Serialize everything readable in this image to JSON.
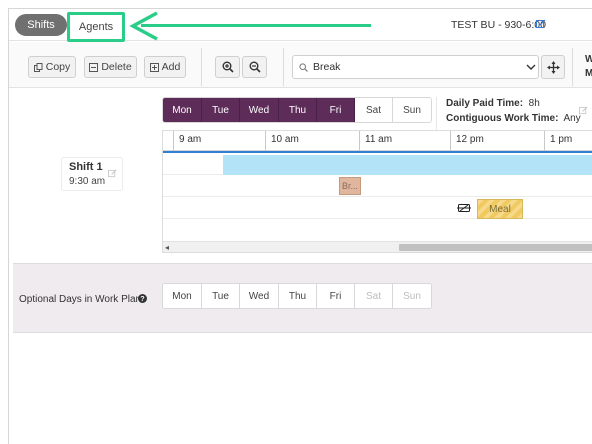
{
  "tabs": {
    "shifts": "Shifts",
    "agents": "Agents"
  },
  "business_unit": "TEST BU - 930-6:00",
  "toolbar": {
    "copy": "Copy",
    "delete": "Delete",
    "add": "Add"
  },
  "search": {
    "value": "Break"
  },
  "cut_off": {
    "line1": "W",
    "line2": "M"
  },
  "shift": {
    "name": "Shift 1",
    "start": "9:30 am"
  },
  "days": [
    {
      "label": "Mon",
      "state": "on"
    },
    {
      "label": "Tue",
      "state": "on"
    },
    {
      "label": "Wed",
      "state": "on"
    },
    {
      "label": "Thu",
      "state": "on"
    },
    {
      "label": "Fri",
      "state": "on"
    },
    {
      "label": "Sat",
      "state": "off"
    },
    {
      "label": "Sun",
      "state": "off"
    }
  ],
  "info": {
    "daily_paid_label": "Daily Paid Time:",
    "daily_paid_value": "8h",
    "contiguous_label": "Contiguous Work Time:",
    "contiguous_value": "Any"
  },
  "timeline": {
    "ticks": [
      "9 am",
      "10 am",
      "11 am",
      "12 pm",
      "1 pm"
    ]
  },
  "activities": {
    "break": "Br...",
    "meal": "Meal"
  },
  "optional": {
    "label": "Optional Days in Work Plan",
    "days": [
      {
        "label": "Mon",
        "state": "off"
      },
      {
        "label": "Tue",
        "state": "off"
      },
      {
        "label": "Wed",
        "state": "off"
      },
      {
        "label": "Thu",
        "state": "off"
      },
      {
        "label": "Fri",
        "state": "off"
      },
      {
        "label": "Sat",
        "state": "dis"
      },
      {
        "label": "Sun",
        "state": "dis"
      }
    ]
  },
  "colors": {
    "accent": "#29cd87",
    "workday": "#5d2c59",
    "shift_bar": "#b3e3f6",
    "break": "#e0b79e",
    "meal": "#f6d98a"
  }
}
